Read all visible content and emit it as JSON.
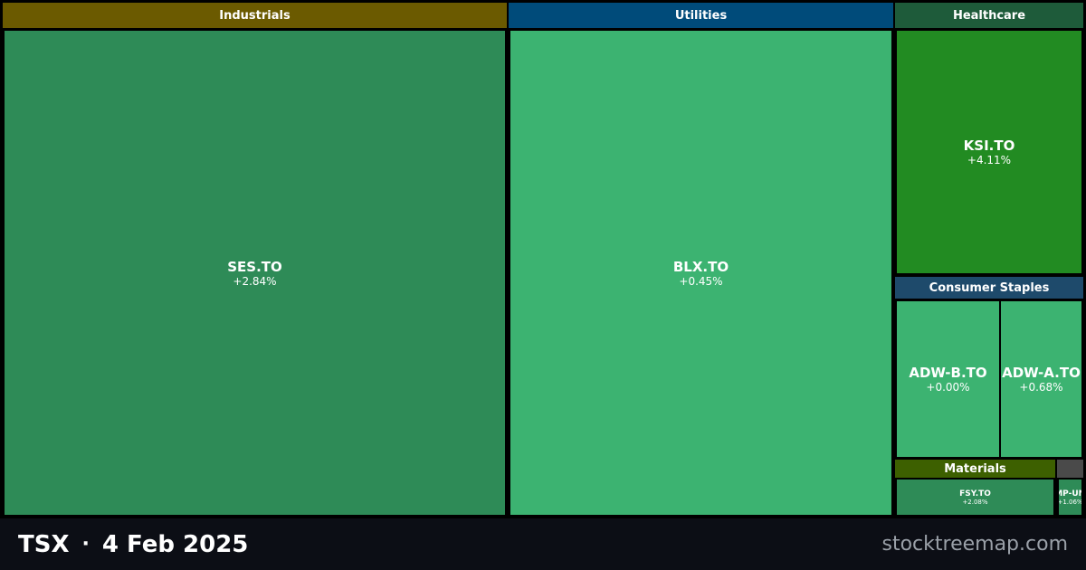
{
  "chart_data": {
    "type": "heatmap",
    "sectors": [
      {
        "name": "Industrials",
        "header_color": "#6b5a00",
        "stocks": [
          {
            "ticker": "SES.TO",
            "change": "+2.84%",
            "color": "#2e8b57"
          }
        ]
      },
      {
        "name": "Utilities",
        "header_color": "#004b7a",
        "stocks": [
          {
            "ticker": "BLX.TO",
            "change": "+0.45%",
            "color": "#3cb371"
          }
        ]
      },
      {
        "name": "Healthcare",
        "header_color": "#1e5b3a",
        "stocks": [
          {
            "ticker": "KSI.TO",
            "change": "+4.11%",
            "color": "#228b22"
          }
        ]
      },
      {
        "name": "Consumer Staples",
        "header_color": "#1e4a6b",
        "stocks": [
          {
            "ticker": "ADW-B.TO",
            "change": "+0.00%",
            "color": "#3cb371"
          },
          {
            "ticker": "ADW-A.TO",
            "change": "+0.68%",
            "color": "#3cb371"
          }
        ]
      },
      {
        "name": "Materials",
        "header_color": "#3d6000",
        "stocks": [
          {
            "ticker": "FSY.TO",
            "change": "+2.08%",
            "color": "#2e8b57"
          }
        ]
      },
      {
        "name": "",
        "header_color": "#4a4a4a",
        "stocks": [
          {
            "ticker": "MMP-UN.T",
            "change": "+1.06%",
            "color": "#2e8b57"
          }
        ]
      }
    ]
  },
  "footer": {
    "exchange": "TSX",
    "separator": "·",
    "date": "4 Feb 2025",
    "site": "stocktreemap.com"
  },
  "colors": {
    "background": "#000000",
    "footer_bg": "#0c0e15",
    "footer_site": "#9aa0a8"
  }
}
